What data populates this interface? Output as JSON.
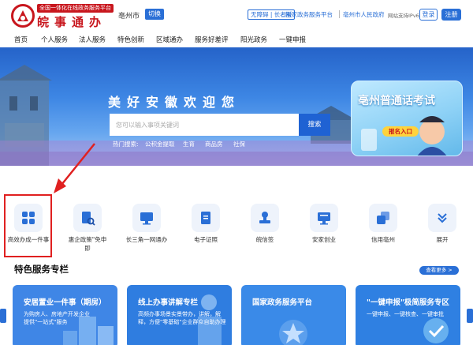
{
  "header": {
    "slogan": "全国一体化在线政务服务平台",
    "brand": "皖事通办",
    "city": "亳州市",
    "switch_label": "切换",
    "accessibility": "无障碍 | 长者版",
    "links": [
      "国家政务服务平台",
      "亳州市人民政府"
    ],
    "ipv6": "网站支持IPv6",
    "login": "登录",
    "register": "注册",
    "brand_color": "#c8161d",
    "accent_color": "#2a6fd6"
  },
  "nav": [
    "首页",
    "个人服务",
    "法人服务",
    "特色创新",
    "区域通办",
    "服务好差评",
    "阳光政务",
    "一键申报"
  ],
  "banner": {
    "welcome": "美好安徽欢迎您",
    "search_placeholder": "您可以输入事项关键词",
    "search_button": "搜索",
    "hot_label": "热门搜索:",
    "hot_items": [
      "公积金提取",
      "生育",
      "商品房",
      "社保"
    ],
    "promo_title": "亳州普通话考试",
    "promo_button": "报名入口"
  },
  "services": [
    {
      "label": "高效办成一件事",
      "icon": "grid-icon"
    },
    {
      "label": "惠企政策\"免申即",
      "icon": "document-search-icon"
    },
    {
      "label": "长三角一网通办",
      "icon": "monitor-icon"
    },
    {
      "label": "电子证照",
      "icon": "certificate-icon"
    },
    {
      "label": "皖信签",
      "icon": "stamp-icon"
    },
    {
      "label": "安家创业",
      "icon": "desktop-icon"
    },
    {
      "label": "信用亳州",
      "icon": "layers-icon"
    },
    {
      "label": "展开",
      "icon": "chevron-down-icon"
    }
  ],
  "special": {
    "title": "特色服务专栏",
    "more": "查看更多 >",
    "cards": [
      {
        "title": "安居置业一件事（期房）",
        "desc": "为购房人、房地产开发企业提供\"一站式\"服务",
        "color": "#3f86e6"
      },
      {
        "title": "线上办事讲解专栏",
        "desc": "高频办事场景实景带办，讲解，解释，方便\"零基础\"企业群众自助办理",
        "color": "#2f7de0"
      },
      {
        "title": "国家政务服务平台",
        "desc": "",
        "color": "#3a8ae8"
      },
      {
        "title": "\"一键申报\"极简服务专区",
        "desc": "一键申报、一键核查、一键审批",
        "color": "#2f80e2"
      }
    ]
  }
}
